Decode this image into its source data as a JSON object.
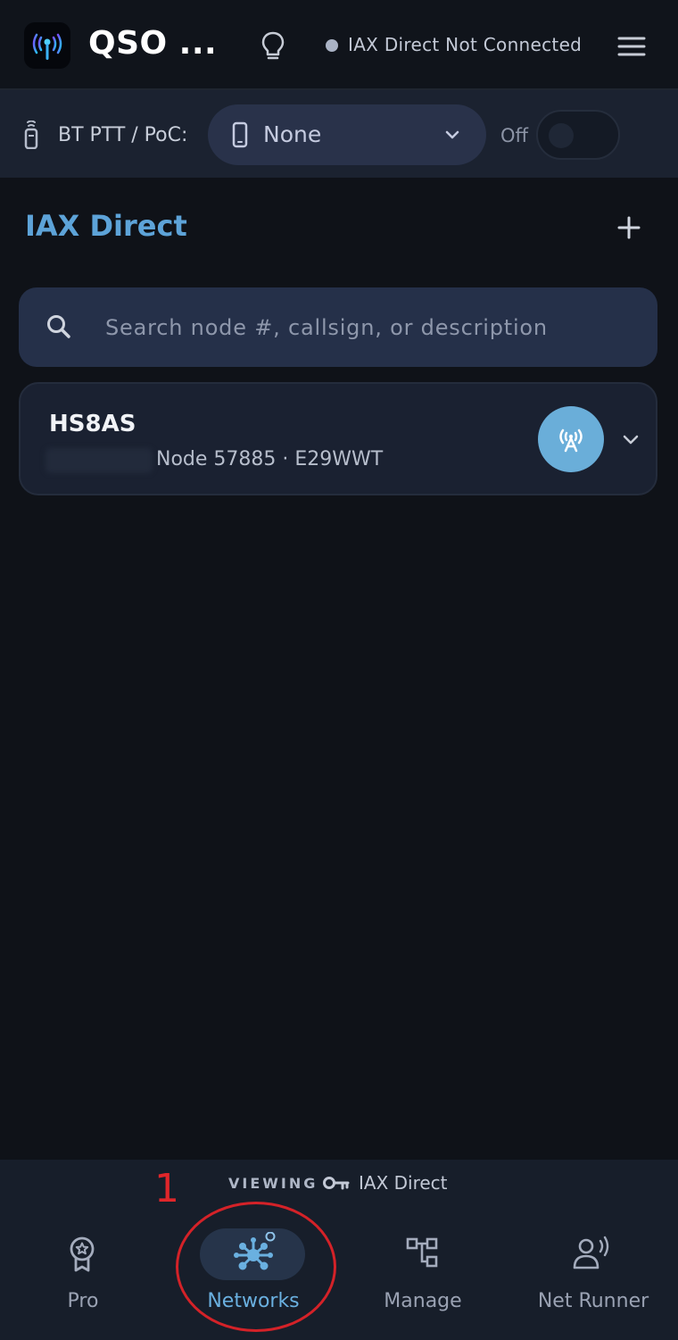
{
  "header": {
    "app_title": "QSO ...",
    "connection_status": "IAX Direct Not Connected"
  },
  "ptt": {
    "label": "BT PTT / PoC:",
    "device_value": "None",
    "toggle_label": "Off",
    "toggle_on": false
  },
  "section": {
    "title": "IAX Direct"
  },
  "search": {
    "placeholder": "Search node #, callsign, or description",
    "value": ""
  },
  "nodes": [
    {
      "callsign": "HS8AS",
      "subtitle": "Node 57885 · E29WWT"
    }
  ],
  "footer": {
    "viewing_label": "VIEWING",
    "viewing_network": "IAX Direct",
    "annotation_number": "1",
    "nav": [
      {
        "label": "Pro",
        "active": false
      },
      {
        "label": "Networks",
        "active": true
      },
      {
        "label": "Manage",
        "active": false
      },
      {
        "label": "Net Runner",
        "active": false
      }
    ]
  },
  "colors": {
    "background": "#0f1218",
    "accent": "#5da3d8",
    "connect_button": "#6aaed9",
    "annotation_red": "#d42228"
  }
}
